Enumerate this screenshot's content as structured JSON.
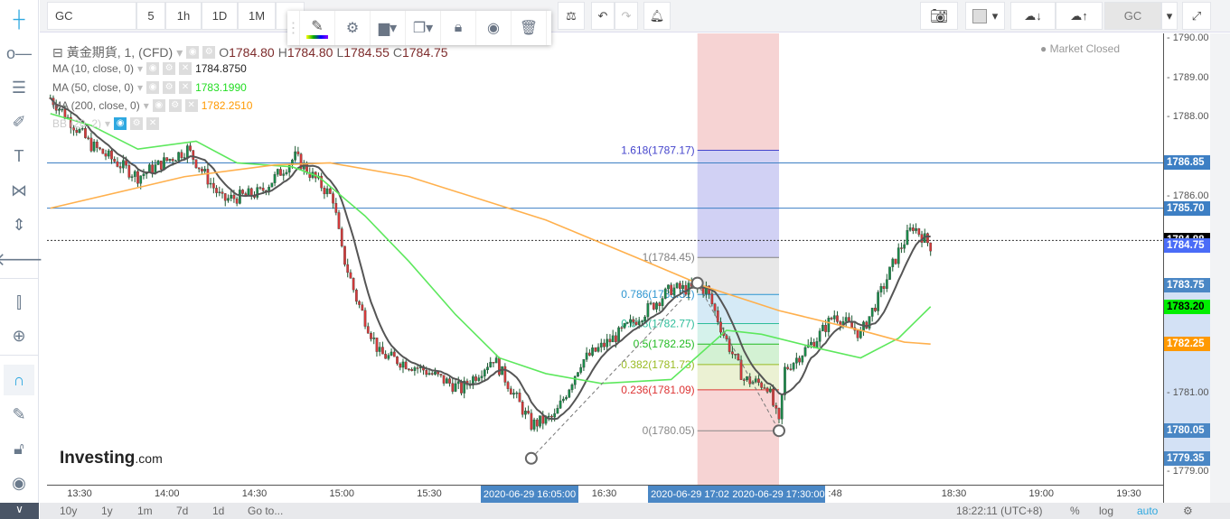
{
  "toolbar": {
    "symbol": "GC",
    "intervals": [
      "5",
      "1h",
      "1D",
      "1M",
      "1"
    ],
    "symbol_right": "GC"
  },
  "legend": {
    "title": "黃金期貨, 1, (CFD)",
    "ohlc": {
      "o": "O",
      "o_val": "1784.80",
      "h": "H",
      "h_val": "1784.80",
      "l": "L",
      "l_val": "1784.55",
      "c": "C",
      "c_val": "1784.75"
    },
    "indicators": [
      {
        "label": "MA (10, close, 0)",
        "value": "1784.8750",
        "color": "#222222"
      },
      {
        "label": "MA (50, close, 0)",
        "value": "1783.1990",
        "color": "#22dd22"
      },
      {
        "label": "MA (200, close, 0)",
        "value": "1782.2510",
        "color": "#ff9900"
      },
      {
        "label": "BB (20, 2)",
        "value": ""
      }
    ]
  },
  "market_status": "Market Closed",
  "brand": {
    "name": "Investing",
    "suffix": ".com"
  },
  "price_axis": {
    "ticks": [
      "1790.00",
      "1789.00",
      "1788.00",
      "1786.00",
      "1781.00",
      "1779.00"
    ],
    "range": [
      1779,
      1790
    ],
    "labels": [
      {
        "text": "1786.85",
        "color": "#3d7fc4"
      },
      {
        "text": "1785.70",
        "color": "#3d7fc4"
      },
      {
        "text": "1784.88",
        "color": "#000000"
      },
      {
        "text": "1784.75",
        "color": "#4a6cf7"
      },
      {
        "text": "1783.75",
        "color": "#4a87c5"
      },
      {
        "text": "1783.20",
        "color": "#00ee00"
      },
      {
        "text": "1782.25",
        "color": "#ff9900"
      },
      {
        "text": "1780.05",
        "color": "#4a87c5"
      },
      {
        "text": "1779.35",
        "color": "#4a87c5"
      }
    ]
  },
  "time_axis": {
    "ticks": [
      "13:30",
      "14:00",
      "14:30",
      "15:00",
      "15:30",
      "16:30",
      "18:30",
      "19:00",
      "19:30"
    ],
    "partial": ":48",
    "highlights": [
      "2020-06-29 16:05:00",
      "2020-06-29 17:02",
      "2020-06-29 17:30:00"
    ]
  },
  "horizontal_lines": [
    1786.85,
    1785.7
  ],
  "last_price_line": 1784.88,
  "fib": {
    "levels": [
      {
        "label": "1.618(1787.17)",
        "price": 1787.17,
        "color": "#4444cc"
      },
      {
        "label": "1(1784.45)",
        "price": 1784.45,
        "color": "#808080"
      },
      {
        "label": "0.786(1783.51)",
        "price": 1783.51,
        "color": "#2d95d0"
      },
      {
        "label": "0.618(1782.77)",
        "price": 1782.77,
        "color": "#2dbd9a"
      },
      {
        "label": "0.5(1782.25)",
        "price": 1782.25,
        "color": "#22bb22"
      },
      {
        "label": "0.382(1781.73)",
        "price": 1781.73,
        "color": "#99bb22"
      },
      {
        "label": "0.236(1781.09)",
        "price": 1781.09,
        "color": "#dd3333"
      },
      {
        "label": "0(1780.05)",
        "price": 1780.05,
        "color": "#888888"
      }
    ],
    "anchors": [
      {
        "time": "16:05",
        "price": 1779.35
      },
      {
        "time": "17:02",
        "price": 1783.8
      },
      {
        "time": "17:30",
        "price": 1780.05
      }
    ]
  },
  "chart_data": {
    "type": "candlestick",
    "price_path": [
      [
        "13:20",
        1788.5
      ],
      [
        "13:34",
        1787.3
      ],
      [
        "13:50",
        1786.5
      ],
      [
        "14:07",
        1787.2
      ],
      [
        "14:19",
        1785.9
      ],
      [
        "14:32",
        1786.1
      ],
      [
        "14:44",
        1787.0
      ],
      [
        "14:57",
        1785.95
      ],
      [
        "15:00",
        1784.6
      ],
      [
        "15:05",
        1783.4
      ],
      [
        "15:13",
        1782.0
      ],
      [
        "15:28",
        1781.6
      ],
      [
        "15:41",
        1781.1
      ],
      [
        "15:52",
        1781.9
      ],
      [
        "16:05",
        1780.2
      ],
      [
        "16:13",
        1780.4
      ],
      [
        "16:22",
        1781.8
      ],
      [
        "16:35",
        1782.5
      ],
      [
        "16:53",
        1783.65
      ],
      [
        "17:05",
        1783.65
      ],
      [
        "17:11",
        1782.5
      ],
      [
        "17:18",
        1781.35
      ],
      [
        "17:26",
        1781.2
      ],
      [
        "17:30",
        1780.2
      ],
      [
        "17:32",
        1781.6
      ],
      [
        "17:43",
        1782.4
      ],
      [
        "17:49",
        1783.0
      ],
      [
        "17:58",
        1782.5
      ],
      [
        "18:04",
        1783.4
      ],
      [
        "18:11",
        1784.6
      ],
      [
        "18:16",
        1785.25
      ],
      [
        "18:22",
        1784.75
      ]
    ],
    "ma50": [
      [
        "13:20",
        1788.1
      ],
      [
        "13:34",
        1787.8
      ],
      [
        "13:50",
        1787.2
      ],
      [
        "14:10",
        1787.4
      ],
      [
        "14:24",
        1786.85
      ],
      [
        "14:43",
        1786.75
      ],
      [
        "14:52",
        1786.5
      ],
      [
        "15:08",
        1785.5
      ],
      [
        "15:23",
        1784.35
      ],
      [
        "15:39",
        1783.0
      ],
      [
        "15:54",
        1781.9
      ],
      [
        "16:10",
        1781.5
      ],
      [
        "16:29",
        1781.25
      ],
      [
        "16:53",
        1781.35
      ],
      [
        "17:12",
        1782.6
      ],
      [
        "17:24",
        1782.5
      ],
      [
        "17:43",
        1782.15
      ],
      [
        "17:58",
        1781.9
      ],
      [
        "18:11",
        1782.4
      ],
      [
        "18:22",
        1783.2
      ]
    ],
    "ma200": [
      [
        "13:20",
        1785.7
      ],
      [
        "14:06",
        1786.5
      ],
      [
        "14:37",
        1786.8
      ],
      [
        "14:56",
        1786.85
      ],
      [
        "15:23",
        1786.5
      ],
      [
        "16:10",
        1785.4
      ],
      [
        "16:41",
        1784.45
      ],
      [
        "17:05",
        1783.7
      ],
      [
        "17:30",
        1783.1
      ],
      [
        "17:58",
        1782.6
      ],
      [
        "18:13",
        1782.3
      ],
      [
        "18:22",
        1782.25
      ]
    ]
  },
  "bottom": {
    "ranges": [
      "10y",
      "1y",
      "1m",
      "7d",
      "1d",
      "Go to..."
    ],
    "clock": "18:22:11 (UTC+8)",
    "pct": "%",
    "log": "log",
    "auto": "auto"
  }
}
